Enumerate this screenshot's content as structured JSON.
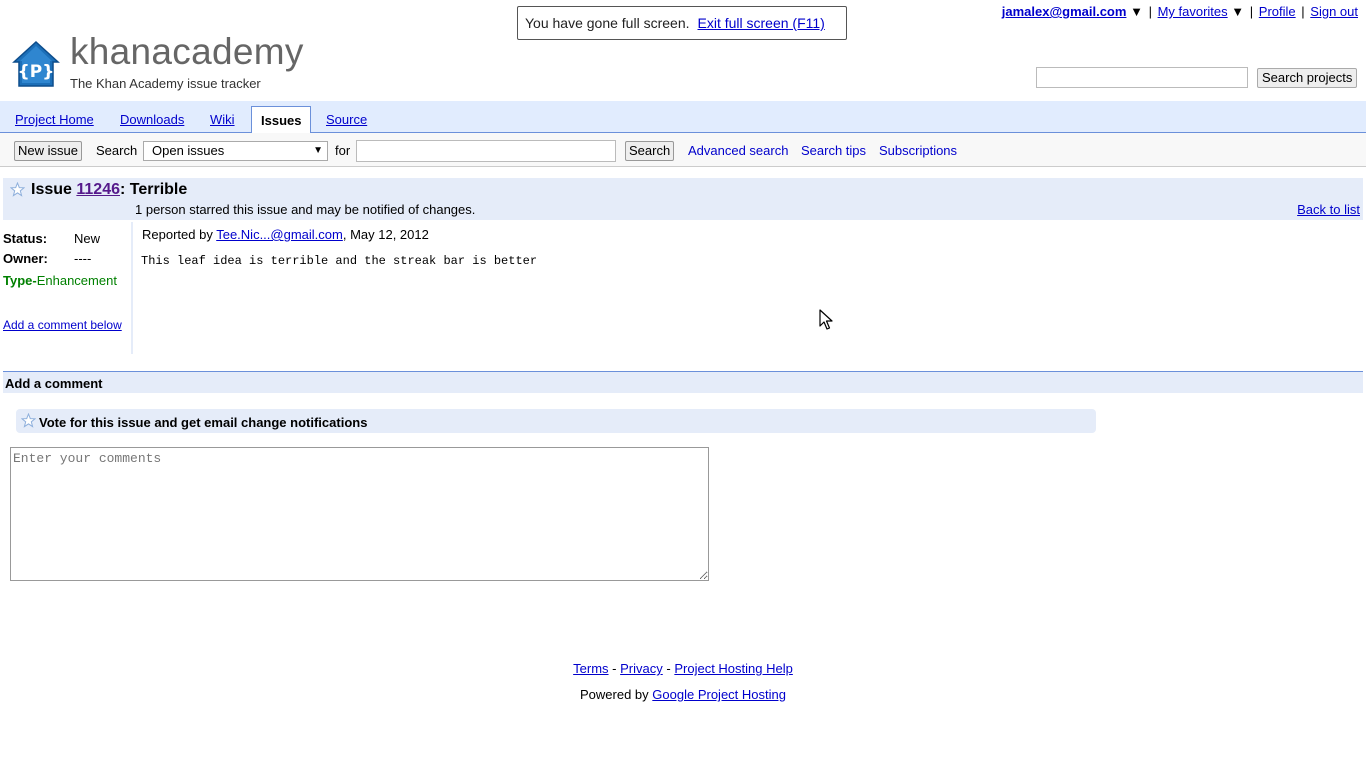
{
  "userbar": {
    "email": "jamalex@gmail.com",
    "favorites": "My favorites",
    "profile": "Profile",
    "signout": "Sign out"
  },
  "fullscreen": {
    "message": "You have gone full screen.",
    "exit_link": "Exit full screen (F11)"
  },
  "project": {
    "name": "khanacademy",
    "description": "The Khan Academy issue tracker",
    "search_button": "Search projects"
  },
  "tabs": [
    {
      "label": "Project Home"
    },
    {
      "label": "Downloads"
    },
    {
      "label": "Wiki"
    },
    {
      "label": "Issues",
      "active": true
    },
    {
      "label": "Source"
    }
  ],
  "toolbar": {
    "new_issue": "New issue",
    "search_label": "Search",
    "scope_selected": "Open issues",
    "for_label": "for",
    "search_button": "Search",
    "advanced_search": "Advanced search",
    "search_tips": "Search tips",
    "subscriptions": "Subscriptions"
  },
  "issue": {
    "prefix": "Issue",
    "id": "11246",
    "title": ": Terrible",
    "stars_text": "1 person starred this issue and may be notified of changes.",
    "back_link": "Back to list",
    "status_key": "Status:",
    "status_value": "New",
    "owner_key": "Owner:",
    "owner_value": "----",
    "type_key": "Type-",
    "type_value": "Enhancement",
    "add_comment_link": "Add a comment below",
    "reported_by_label": "Reported by",
    "reporter": "Tee.Nic...@gmail.com",
    "reported_date": ", May 12, 2012",
    "description": "This leaf idea is terrible and the streak bar is better",
    "type_color": "#008000"
  },
  "comment": {
    "section_label": "Add a comment",
    "vote_label": "Vote for this issue and get email change notifications",
    "placeholder": "Enter your comments"
  },
  "footer": {
    "terms": "Terms",
    "privacy": "Privacy",
    "help": "Project Hosting Help",
    "powered_label": "Powered by",
    "powered_link": "Google Project Hosting"
  }
}
